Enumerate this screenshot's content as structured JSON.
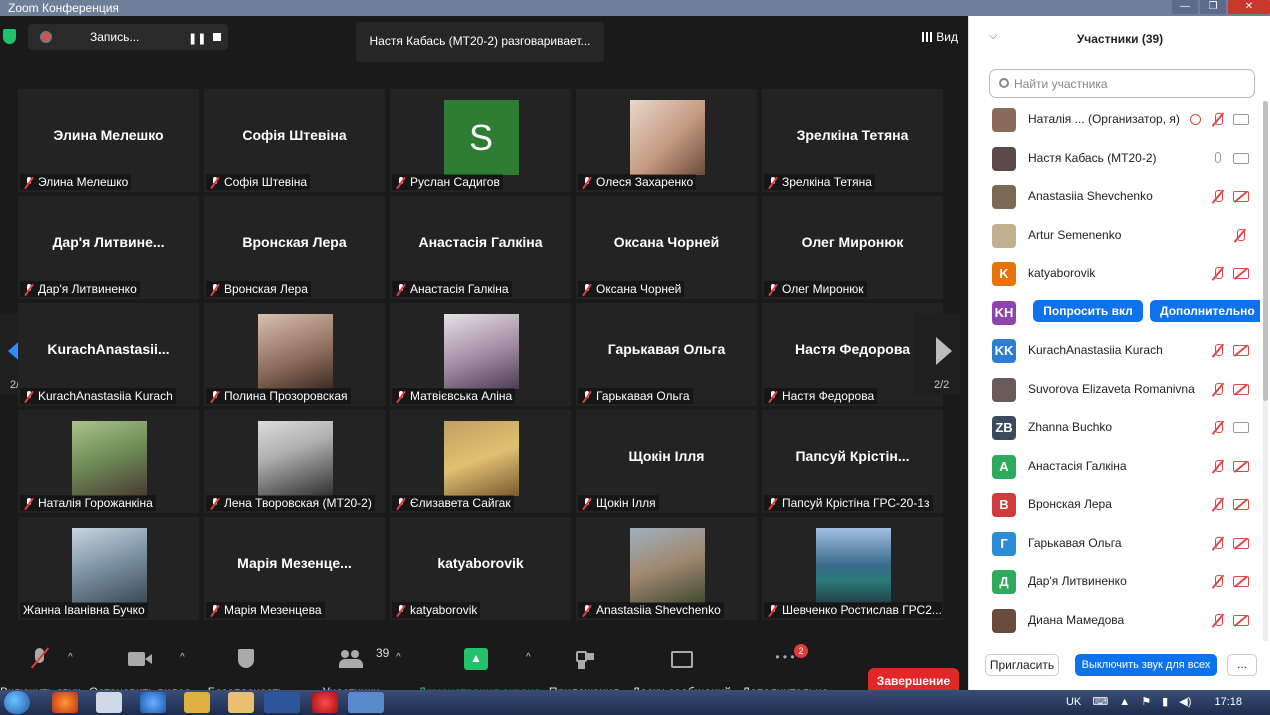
{
  "window": {
    "title": "Zoom Конференция",
    "controls": [
      "—",
      "❐",
      "✕"
    ]
  },
  "topbar": {
    "recording_label": "Запись...",
    "speaking_text": "Настя Кабась (МТ20-2) разговаривает...",
    "view_label": "Вид"
  },
  "gallery": {
    "page_left": "2/2",
    "page_right": "2/2",
    "tiles": [
      {
        "big": "Элина Мелешко",
        "label": "Элина Мелешко",
        "muted": true,
        "kind": "name"
      },
      {
        "big": "Софія Штевіна",
        "label": "Софія Штевіна",
        "muted": true,
        "kind": "name"
      },
      {
        "big": "S",
        "label": "Руслан Садигов",
        "muted": true,
        "kind": "avatar"
      },
      {
        "big": "",
        "label": "Олеся Захаренко",
        "muted": true,
        "kind": "photo",
        "photo": "ph1"
      },
      {
        "big": "Зрелкіна Тетяна",
        "label": "Зрелкіна Тетяна",
        "muted": true,
        "kind": "name"
      },
      {
        "big": "Дар'я  Литвине...",
        "label": "Дар'я Литвиненко",
        "muted": true,
        "kind": "name"
      },
      {
        "big": "Вронская Лера",
        "label": "Вронская Лера",
        "muted": true,
        "kind": "name"
      },
      {
        "big": "Анастасія Галкіна",
        "label": "Анастасія Галкіна",
        "muted": true,
        "kind": "name"
      },
      {
        "big": "Оксана Чорней",
        "label": "Оксана Чорней",
        "muted": true,
        "kind": "name"
      },
      {
        "big": "Олег Миронюк",
        "label": "Олег Миронюк",
        "muted": true,
        "kind": "name"
      },
      {
        "big": "KurachAnastasii...",
        "label": "KurachAnastasiia Kurach",
        "muted": true,
        "kind": "name"
      },
      {
        "big": "",
        "label": "Полина Прозоровская",
        "muted": true,
        "kind": "photo",
        "photo": "ph2"
      },
      {
        "big": "",
        "label": "Матвієвська Аліна",
        "muted": true,
        "kind": "photo",
        "photo": "ph3"
      },
      {
        "big": "Гарькавая Ольга",
        "label": "Гарькавая Ольга",
        "muted": true,
        "kind": "name"
      },
      {
        "big": "Настя Федорова",
        "label": "Настя Федорова",
        "muted": true,
        "kind": "name"
      },
      {
        "big": "",
        "label": "Наталія Горожанкіна",
        "muted": true,
        "kind": "photo",
        "photo": "ph4"
      },
      {
        "big": "",
        "label": "Лена Творовская (МТ20-2)",
        "muted": true,
        "kind": "photo",
        "photo": "ph5"
      },
      {
        "big": "",
        "label": "Єлизавета Сайгак",
        "muted": true,
        "kind": "photo",
        "photo": "ph6"
      },
      {
        "big": "Щокін Ілля",
        "label": "Щокін Ілля",
        "muted": true,
        "kind": "name"
      },
      {
        "big": "Папсуй  Крістін...",
        "label": "Папсуй Крістіна ГРС-20-1з",
        "muted": true,
        "kind": "name"
      },
      {
        "big": "",
        "label": "Жанна Іванівна Бучко",
        "muted": false,
        "kind": "photo",
        "photo": "ph7"
      },
      {
        "big": "Марія  Мезенце...",
        "label": "Марія Мезенцева",
        "muted": true,
        "kind": "name"
      },
      {
        "big": "katyaborovik",
        "label": "katyaborovik",
        "muted": true,
        "kind": "name"
      },
      {
        "big": "",
        "label": "Anastasiia Shevchenko",
        "muted": true,
        "kind": "photo",
        "photo": "ph8"
      },
      {
        "big": "",
        "label": "Шевченко Ростислав ГРС2...",
        "muted": true,
        "kind": "photo",
        "photo": "ph9"
      }
    ]
  },
  "toolbar": {
    "unmute": "Включить звук",
    "stop_video": "Остановить видео",
    "security": "Безопасность",
    "participants": "Участники",
    "participants_count": "39",
    "share": "Демонстрация экрана",
    "apps": "Приложения",
    "boards": "Доски сообщений",
    "more": "Дополнительно",
    "more_badge": "2",
    "end": "Завершение"
  },
  "panel": {
    "title": "Участники (39)",
    "search_placeholder": "Найти участника",
    "ask_button": "Попросить вкл",
    "more_button": "Дополнительно",
    "invite": "Пригласить",
    "mute_all": "Выключить звук для всех",
    "dots": "...",
    "participants": [
      {
        "name": "Наталія ...   (Организатор, я)",
        "avatar": "",
        "color": "#8a6a58",
        "icons": "host"
      },
      {
        "name": "Настя Кабась (МТ20-2)",
        "avatar": "",
        "color": "#5a4a48",
        "icons": "on"
      },
      {
        "name": "Anastasiia Shevchenko",
        "avatar": "",
        "color": "#7a6a55",
        "icons": "off"
      },
      {
        "name": "Artur Semenenko",
        "avatar": "",
        "color": "#c0b090",
        "icons": "micoff"
      },
      {
        "name": "katyaborovik",
        "avatar": "K",
        "color": "#e8710a",
        "icons": "off"
      },
      {
        "name": "",
        "avatar": "KH",
        "color": "#8e44ad",
        "icons": "hover"
      },
      {
        "name": "KurachAnastasiia Kurach",
        "avatar": "KK",
        "color": "#2d7dd2",
        "icons": "off"
      },
      {
        "name": "Suvorova Elizaveta Romanivna",
        "avatar": "",
        "color": "#6a5a5a",
        "icons": "off"
      },
      {
        "name": "Zhanna Buchko",
        "avatar": "ZB",
        "color": "#3a4a5c",
        "icons": "micoffcamon"
      },
      {
        "name": "Анастасія Галкіна",
        "avatar": "A",
        "color": "#2eaa5c",
        "icons": "off"
      },
      {
        "name": "Вронская Лера",
        "avatar": "B",
        "color": "#d03b3b",
        "icons": "off"
      },
      {
        "name": "Гарькавая Ольга",
        "avatar": "Г",
        "color": "#2d8cd8",
        "icons": "off"
      },
      {
        "name": "Дар'я Литвиненко",
        "avatar": "Д",
        "color": "#2eaa5c",
        "icons": "off"
      },
      {
        "name": "Диана Мамедова",
        "avatar": "",
        "color": "#6a4a3a",
        "icons": "off"
      }
    ]
  },
  "taskbar": {
    "lang": "UK",
    "time": "17:18"
  }
}
